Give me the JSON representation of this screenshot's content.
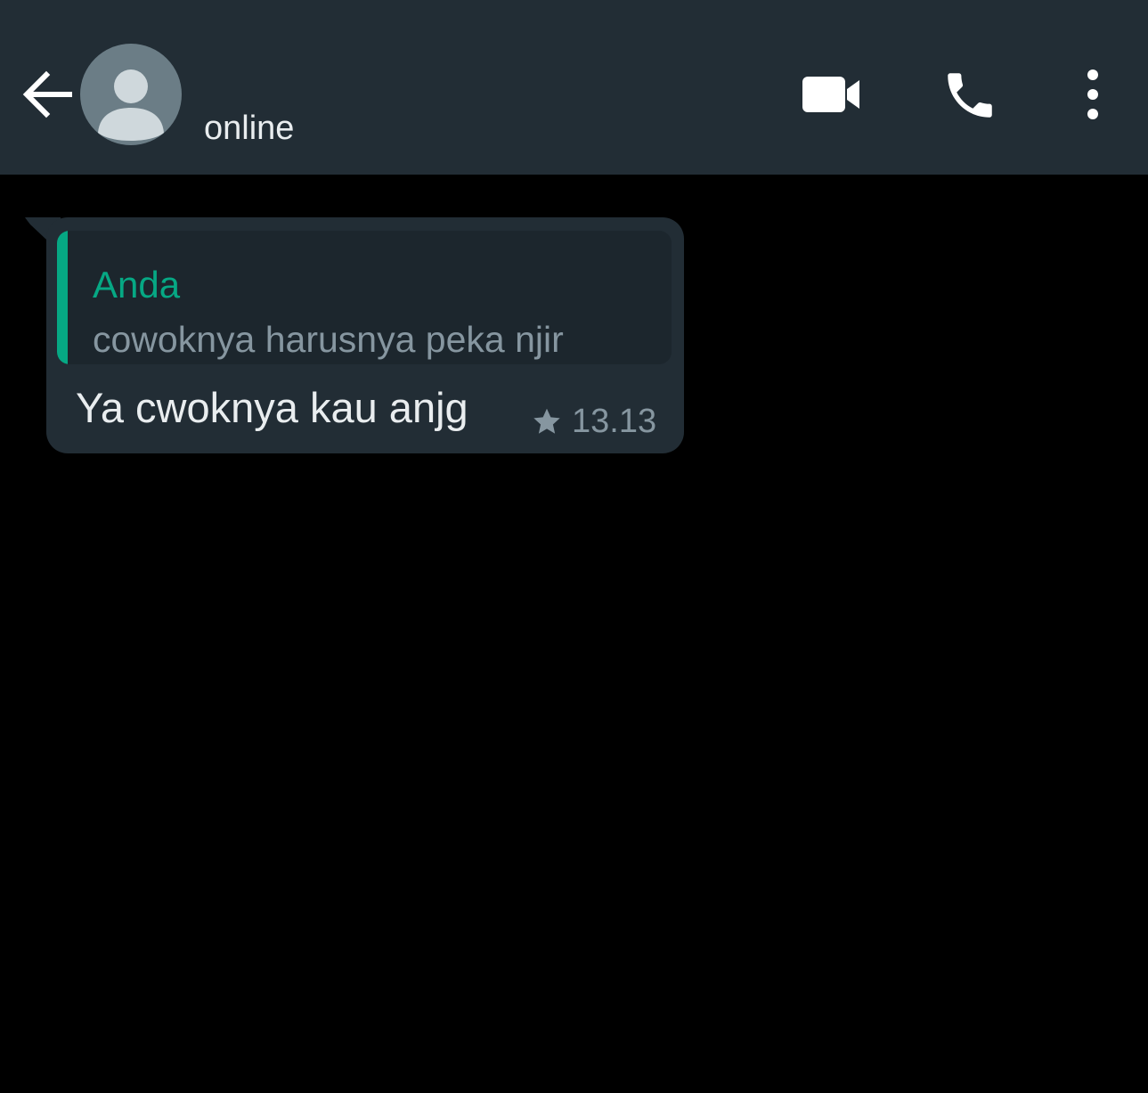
{
  "header": {
    "back_icon": "arrow-left-icon",
    "avatar_icon": "default-person-avatar-icon",
    "status": "online",
    "actions": [
      {
        "icon": "video-camera-icon"
      },
      {
        "icon": "phone-icon"
      },
      {
        "icon": "more-vertical-icon"
      }
    ]
  },
  "messages": [
    {
      "quoted": {
        "author": "Anda",
        "text": "cowoknya harusnya peka njir"
      },
      "text": "Ya cwoknya kau anjg",
      "starred": true,
      "star_icon": "star-icon",
      "time": "13.13"
    }
  ],
  "colors": {
    "header_bg": "#222d35",
    "chat_bg": "#000000",
    "bubble_bg": "#222d35",
    "quote_bg": "#1c262d",
    "accent": "#06a884",
    "primary_text": "#e9edef",
    "secondary_text": "#8696a0",
    "avatar_bg": "#6b7d86",
    "avatar_fg": "#cfd8dc"
  }
}
